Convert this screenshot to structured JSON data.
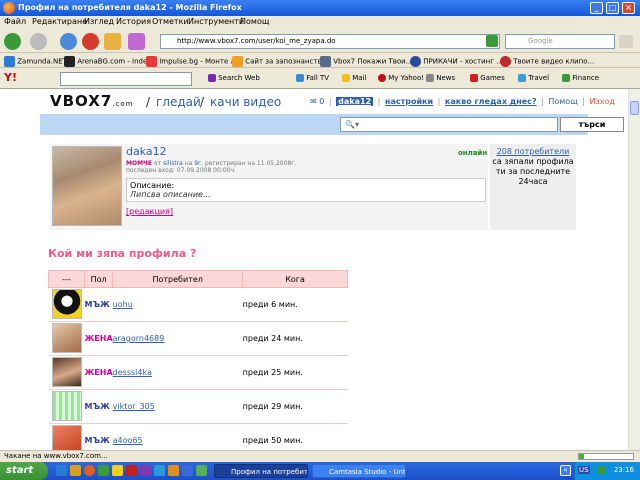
{
  "window": {
    "title": "Профил на потребителя daka12 - Mozilla Firefox"
  },
  "menu": [
    "Файл",
    "Редактиране",
    "Изглед",
    "История",
    "Отметки",
    "Инструменти",
    "Помощ"
  ],
  "nav": {
    "url": "http://www.vbox7.com/user/koi_me_zyapa.do",
    "search_placeholder": "Google"
  },
  "bookmarks": [
    "Zamunda.NET",
    "ArenaBG.com - Index",
    "Impulse.bg - Монте л...",
    "Сайт за запознанства",
    "Vbox7 Покажи Твои...",
    "ПРИКАЧИ - хостинг ...",
    "Твоите видео клипо..."
  ],
  "yahoo": {
    "items": [
      "Search Web",
      "Fall TV",
      "Mail",
      "My Yahoo!",
      "News",
      "Games",
      "Travel",
      "Finance"
    ]
  },
  "site": {
    "logo": "VBOX7",
    "logo_suffix": ".com",
    "nav_watch": "гледай",
    "nav_upload": "качи видео",
    "msg_count": "0",
    "username": "daka12",
    "settings": "настройки",
    "what_watch": "какво гледах днес?",
    "help": "Помощ",
    "exit": "Изход",
    "search_button": "търси"
  },
  "profile": {
    "name": "daka12",
    "status": "онлайн",
    "gender": "МОМЧЕ",
    "from_label": "от",
    "city": "silistra",
    "age_label": "на",
    "age": "9г.",
    "registered": "регистриран на 11.05.2008г.",
    "last_login": "последен вход: 07.09.2008 00:00ч.",
    "desc_label": "Описание:",
    "desc_text": "Липсва описание...",
    "edit": "[редакция]"
  },
  "visitors": {
    "count": "208 потребители",
    "text": "са зяпали профила ти за последните 24часа"
  },
  "section_title": "Кой ми зяпа профила ?",
  "table": {
    "headers": [
      "---",
      "Пол",
      "Потребител",
      "Кога"
    ],
    "rows": [
      {
        "sex": "МЪЖ",
        "user": "uohu",
        "when": "преди 6 мин."
      },
      {
        "sex": "ЖЕНА",
        "user": "aragorn4689",
        "when": "преди 24 мин."
      },
      {
        "sex": "ЖЕНА",
        "user": "desssi4ka",
        "when": "преди 25 мин."
      },
      {
        "sex": "МЪЖ",
        "user": "viktor_305",
        "when": "преди 29 мин."
      },
      {
        "sex": "МЪЖ",
        "user": "a4oo65",
        "when": "преди 50 мин."
      }
    ]
  },
  "status": {
    "text": "Чакане на www.vbox7.com...",
    "progress": 0.1
  },
  "taskbar": {
    "start": "start",
    "tasks": [
      "Профил на потребит...",
      "Camtasia Studio - Unti..."
    ],
    "tray_lang": "US",
    "clock": "23:16"
  }
}
